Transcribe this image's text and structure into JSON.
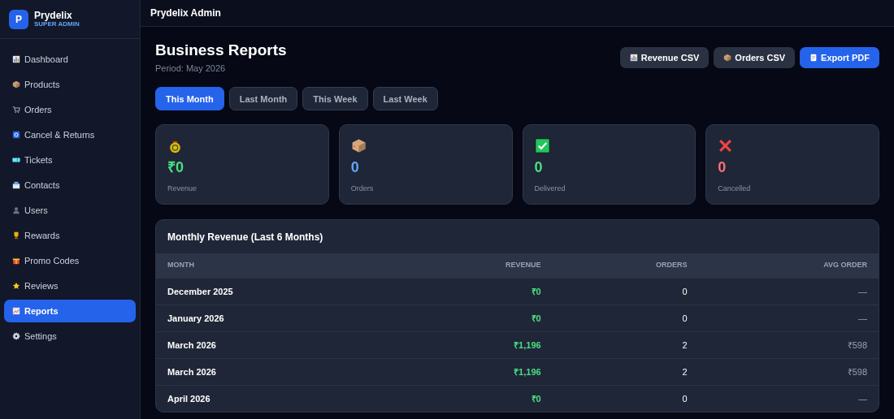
{
  "brand": {
    "initial": "P",
    "name": "Prydelix",
    "role": "SUPER ADMIN"
  },
  "sidebar": {
    "items": [
      {
        "label": "Dashboard",
        "selected": false
      },
      {
        "label": "Products",
        "selected": false
      },
      {
        "label": "Orders",
        "selected": false
      },
      {
        "label": "Cancel & Returns",
        "selected": false
      },
      {
        "label": "Tickets",
        "selected": false
      },
      {
        "label": "Contacts",
        "selected": false
      },
      {
        "label": "Users",
        "selected": false
      },
      {
        "label": "Rewards",
        "selected": false
      },
      {
        "label": "Promo Codes",
        "selected": false
      },
      {
        "label": "Reviews",
        "selected": false
      },
      {
        "label": "Reports",
        "selected": true
      },
      {
        "label": "Settings",
        "selected": false
      }
    ]
  },
  "topbar": {
    "title": "Prydelix Admin"
  },
  "header": {
    "title": "Business Reports",
    "period": "Period: May 2026"
  },
  "actions": [
    {
      "label": "Revenue CSV",
      "kind": "secondary"
    },
    {
      "label": "Orders CSV",
      "kind": "secondary"
    },
    {
      "label": "Export PDF",
      "kind": "primary"
    }
  ],
  "tabs": [
    {
      "label": "This Month",
      "selected": true
    },
    {
      "label": "Last Month",
      "selected": false
    },
    {
      "label": "This Week",
      "selected": false
    },
    {
      "label": "Last Week",
      "selected": false
    }
  ],
  "stats": [
    {
      "value": "₹0",
      "label": "Revenue",
      "color": "#4ade80"
    },
    {
      "value": "0",
      "label": "Orders",
      "color": "#60a5fa"
    },
    {
      "value": "0",
      "label": "Delivered",
      "color": "#4ade80"
    },
    {
      "value": "0",
      "label": "Cancelled",
      "color": "#f87171"
    }
  ],
  "table": {
    "title": "Monthly Revenue (Last 6 Months)",
    "columns": [
      "MONTH",
      "REVENUE",
      "ORDERS",
      "AVG ORDER"
    ],
    "rows": [
      [
        "December 2025",
        "₹0",
        "0",
        "—"
      ],
      [
        "January 2026",
        "₹0",
        "0",
        "—"
      ],
      [
        "March 2026",
        "₹1,196",
        "2",
        "₹598"
      ],
      [
        "March 2026",
        "₹1,196",
        "2",
        "₹598"
      ],
      [
        "April 2026",
        "₹0",
        "0",
        "—"
      ]
    ]
  }
}
